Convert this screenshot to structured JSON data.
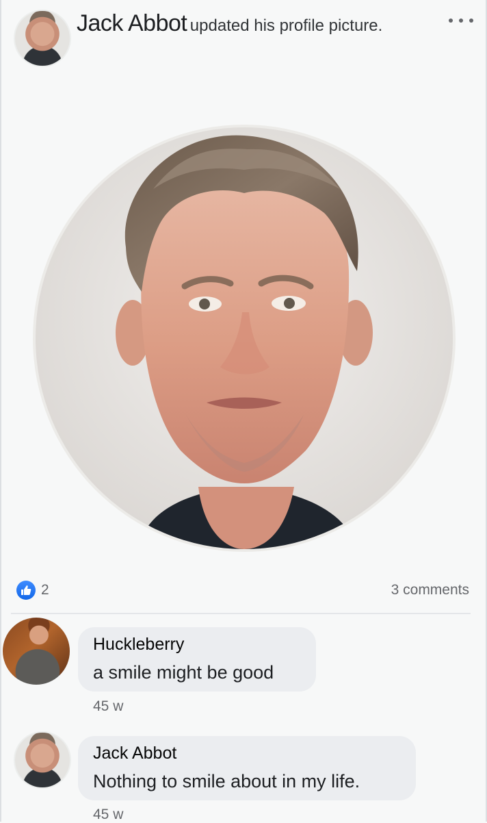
{
  "post": {
    "author": "Jack Abbot",
    "action": "updated his profile picture."
  },
  "icons": {
    "more": "more-horizontal-icon",
    "like": "like-thumb-icon"
  },
  "stats": {
    "likes": "2",
    "comments": "3 comments"
  },
  "comments": [
    {
      "author": "Huckleberry",
      "text": "a smile might be good",
      "time": "45 w"
    },
    {
      "author": "Jack Abbot",
      "text": "Nothing to smile about in my life.",
      "time": "45 w"
    }
  ],
  "colors": {
    "accent": "#1877f2",
    "bubble": "#ebedf0",
    "muted": "#65676b"
  }
}
